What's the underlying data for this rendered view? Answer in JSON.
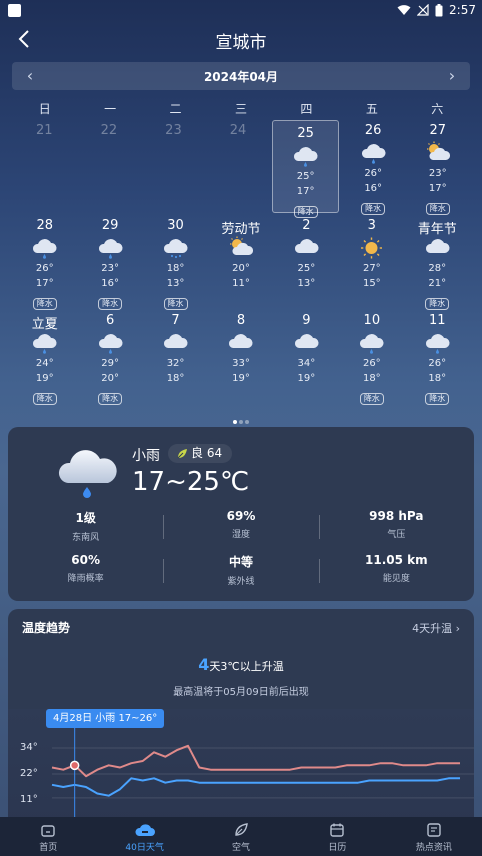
{
  "status_bar": {
    "time": "2:57"
  },
  "header": {
    "title": "宣城市"
  },
  "month_nav": {
    "label": "2024年04月"
  },
  "weekdays": [
    "日",
    "一",
    "二",
    "三",
    "四",
    "五",
    "六"
  ],
  "calendar": {
    "rows": [
      [
        {
          "day": "21",
          "past": true
        },
        {
          "day": "22",
          "past": true
        },
        {
          "day": "23",
          "past": true
        },
        {
          "day": "24",
          "past": true
        },
        {
          "day": "25",
          "icon": "rain",
          "hi": "25°",
          "lo": "17°",
          "tag": "降水",
          "selected": true
        },
        {
          "day": "26",
          "icon": "rain",
          "hi": "26°",
          "lo": "16°",
          "tag": "降水"
        },
        {
          "day": "27",
          "icon": "partly-cloudy",
          "hi": "23°",
          "lo": "17°",
          "tag": "降水"
        }
      ],
      [
        {
          "day": "28",
          "icon": "rain",
          "hi": "26°",
          "lo": "17°",
          "tag": "降水"
        },
        {
          "day": "29",
          "icon": "rain",
          "hi": "23°",
          "lo": "16°",
          "tag": "降水"
        },
        {
          "day": "30",
          "icon": "heavy-rain",
          "hi": "18°",
          "lo": "13°",
          "tag": "降水"
        },
        {
          "day": "劳动节",
          "icon": "partly-cloudy",
          "hi": "20°",
          "lo": "11°"
        },
        {
          "day": "2",
          "icon": "cloudy",
          "hi": "25°",
          "lo": "13°"
        },
        {
          "day": "3",
          "icon": "sunny",
          "hi": "27°",
          "lo": "15°"
        },
        {
          "day": "青年节",
          "icon": "cloudy",
          "hi": "28°",
          "lo": "21°",
          "tag": "降水"
        }
      ],
      [
        {
          "day": "立夏",
          "icon": "rain",
          "hi": "24°",
          "lo": "19°",
          "tag": "降水"
        },
        {
          "day": "6",
          "icon": "rain",
          "hi": "29°",
          "lo": "20°",
          "tag": "降水"
        },
        {
          "day": "7",
          "icon": "cloudy",
          "hi": "32°",
          "lo": "18°"
        },
        {
          "day": "8",
          "icon": "cloudy",
          "hi": "33°",
          "lo": "19°"
        },
        {
          "day": "9",
          "icon": "cloudy",
          "hi": "34°",
          "lo": "19°"
        },
        {
          "day": "10",
          "icon": "rain",
          "hi": "26°",
          "lo": "18°",
          "tag": "降水"
        },
        {
          "day": "11",
          "icon": "rain",
          "hi": "26°",
          "lo": "18°",
          "tag": "降水"
        }
      ]
    ]
  },
  "today": {
    "condition": "小雨",
    "aqi_label": "良 64",
    "temp_range": "17~25℃",
    "stats": [
      {
        "value": "1级",
        "label": "东南风"
      },
      {
        "value": "69%",
        "label": "湿度"
      },
      {
        "value": "998 hPa",
        "label": "气压"
      },
      {
        "value": "60%",
        "label": "降雨概率"
      },
      {
        "value": "中等",
        "label": "紫外线"
      },
      {
        "value": "11.05 km",
        "label": "能见度"
      }
    ]
  },
  "trend": {
    "title": "温度趋势",
    "more": "4天升温",
    "summary_num": "4",
    "summary_text": "天3℃以上升温",
    "subtext": "最高温将于05月09日前后出现",
    "tooltip": "4月28日 小雨 17~26°",
    "y_ticks": [
      "34°",
      "22°",
      "11°"
    ]
  },
  "chart_data": {
    "type": "line",
    "y_ticks": [
      34,
      22,
      11
    ],
    "series": [
      {
        "values": [
          25,
          24,
          26,
          21,
          24,
          26,
          25,
          27,
          28,
          32,
          30,
          33,
          35,
          25,
          24,
          24,
          24,
          24,
          24,
          24,
          24,
          24,
          25,
          25,
          25,
          25,
          26,
          26,
          26,
          27,
          27,
          26,
          26,
          26,
          27,
          27,
          27
        ]
      },
      {
        "values": [
          17,
          16,
          17,
          16,
          13,
          12,
          15,
          20,
          19,
          20,
          18,
          19,
          19,
          18,
          18,
          18,
          18,
          18,
          18,
          18,
          18,
          18,
          18,
          18,
          18,
          18,
          18,
          18,
          19,
          19,
          19,
          19,
          19,
          19,
          19,
          20,
          20
        ]
      }
    ]
  },
  "bottom_nav": [
    {
      "label": "首页",
      "icon": "home-icon"
    },
    {
      "label": "40日天气",
      "icon": "cloud-icon",
      "active": true
    },
    {
      "label": "空气",
      "icon": "leaf-icon"
    },
    {
      "label": "日历",
      "icon": "calendar-icon"
    },
    {
      "label": "热点资讯",
      "icon": "news-icon"
    }
  ],
  "colors": {
    "accent": "#4aa3ff",
    "high_line": "#e08a8a",
    "low_line": "#4aa3ff",
    "card": "#2e3a52"
  }
}
